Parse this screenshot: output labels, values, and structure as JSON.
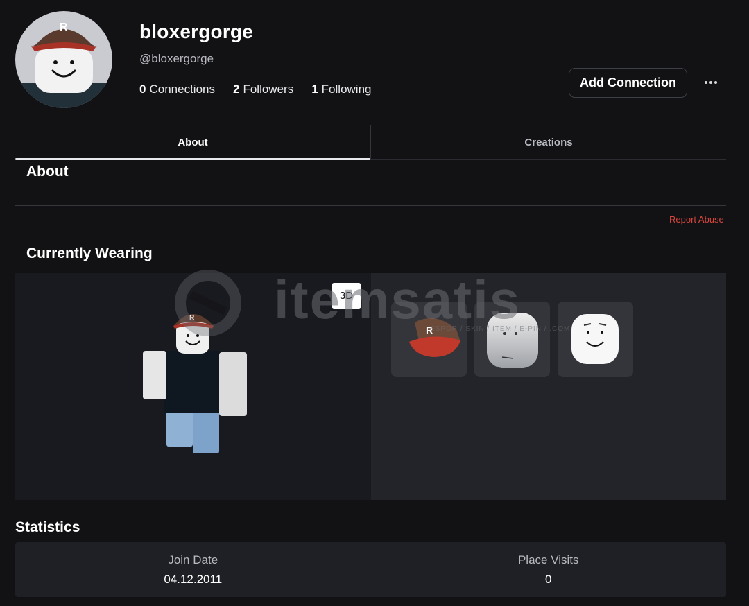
{
  "profile": {
    "display_name": "bloxergorge",
    "username": "@bloxergorge",
    "connections_count": "0",
    "connections_label": "Connections",
    "followers_count": "2",
    "followers_label": "Followers",
    "following_count": "1",
    "following_label": "Following"
  },
  "actions": {
    "add_connection_label": "Add Connection",
    "more_icon": "ellipsis-icon"
  },
  "tabs": [
    {
      "label": "About",
      "active": true
    },
    {
      "label": "Creations",
      "active": false
    }
  ],
  "about": {
    "title": "About",
    "report_abuse_label": "Report Abuse"
  },
  "wearing": {
    "title": "Currently Wearing",
    "view_toggle_label": "3D",
    "items": [
      {
        "name": "red-baseball-cap"
      },
      {
        "name": "gray-head"
      },
      {
        "name": "smile-face-head"
      }
    ]
  },
  "watermark": {
    "text": "itemsatis",
    "subtext": "ESPOR / SKIN / ITEM / E-PIN / .COM"
  },
  "statistics": {
    "title": "Statistics",
    "join_date_label": "Join Date",
    "join_date_value": "04.12.2011",
    "place_visits_label": "Place Visits",
    "place_visits_value": "0"
  },
  "colors": {
    "background": "#121215",
    "panel": "#1f2025",
    "report_abuse": "#d9463d",
    "cap_red": "#c0392b",
    "cap_brown": "#5b3a2e"
  }
}
